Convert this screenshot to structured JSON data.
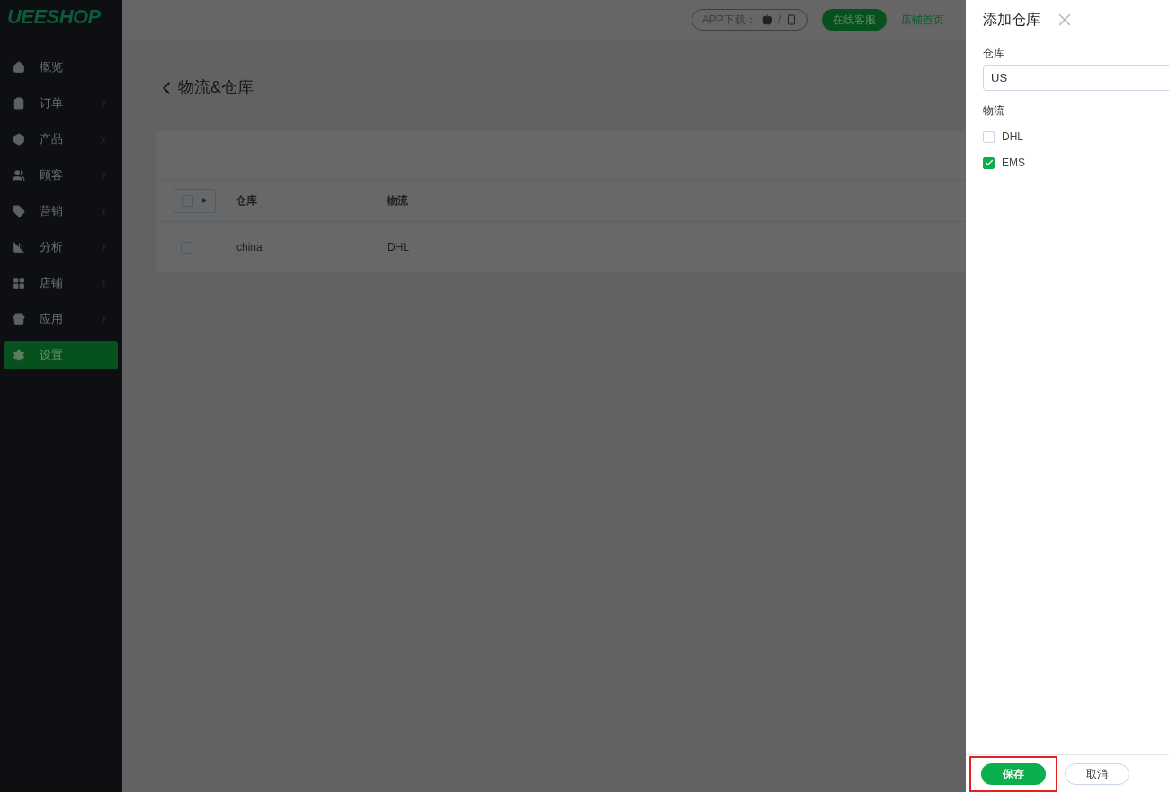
{
  "logo": "UEESHOP",
  "sidebar": {
    "items": [
      {
        "label": "概览",
        "has_submenu": false,
        "selected": false
      },
      {
        "label": "订单",
        "has_submenu": true,
        "selected": false
      },
      {
        "label": "产品",
        "has_submenu": true,
        "selected": false
      },
      {
        "label": "顾客",
        "has_submenu": true,
        "selected": false
      },
      {
        "label": "营销",
        "has_submenu": true,
        "selected": false
      },
      {
        "label": "分析",
        "has_submenu": true,
        "selected": false
      },
      {
        "label": "店铺",
        "has_submenu": true,
        "selected": false
      },
      {
        "label": "应用",
        "has_submenu": true,
        "selected": false
      },
      {
        "label": "设置",
        "has_submenu": false,
        "selected": true
      }
    ]
  },
  "header": {
    "app_download": "APP下载：",
    "separator": "/",
    "support_button": "在线客服",
    "store_link": "店铺首页"
  },
  "page": {
    "title": "物流&仓库"
  },
  "table": {
    "select_all_checked": false,
    "columns": [
      "仓库",
      "物流"
    ],
    "rows": [
      {
        "cells": [
          "china",
          "DHL"
        ],
        "checked": false
      }
    ]
  },
  "drawer": {
    "title": "添加仓库",
    "warehouse_label": "仓库",
    "warehouse_value": "US",
    "logistics_label": "物流",
    "options": [
      {
        "label": "DHL",
        "checked": false
      },
      {
        "label": "EMS",
        "checked": true
      }
    ],
    "save_button": "保存",
    "cancel_button": "取消",
    "save_highlighted": true
  }
}
